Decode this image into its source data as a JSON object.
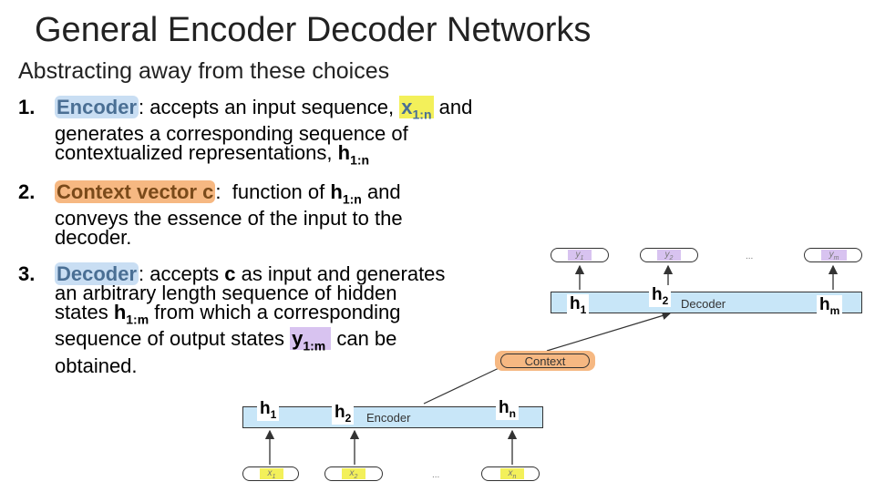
{
  "title": "General Encoder Decoder Networks",
  "subtitle": "Abstracting away from these choices",
  "items": [
    {
      "num": "1.",
      "keyword": "Encoder",
      "colon": ":",
      "l1a": " accepts an input sequence, ",
      "l1x": "x",
      "l1xsub": "1:n",
      "l1b": " and",
      "l2": "generates a corresponding sequence of",
      "l3a": "contextualized representations, ",
      "l3h": "h",
      "l3hsub": "1:n"
    },
    {
      "num": "2.",
      "keyword": "Context vector c",
      "colon": ":",
      "l1a": "  function of ",
      "l1h": "h",
      "l1hsub": "1:n",
      "l1b": " and",
      "l2": "conveys the essence of the input to the",
      "l3": "decoder."
    },
    {
      "num": "3.",
      "keyword": "Decoder",
      "colon": ":",
      "l1a": " accepts ",
      "l1c": "c",
      "l1b": " as input and generates",
      "l2": "an arbitrary length sequence of hidden",
      "l3a": "states ",
      "l3h": "h",
      "l3hsub": "1:m",
      "l3b": " from which a corresponding",
      "l4a": "sequence of output states ",
      "l4y": "y",
      "l4ysub": "1:m",
      "l4b": " can be",
      "l5": "obtained."
    }
  ],
  "diagram": {
    "encoder_label": "Encoder",
    "decoder_label": "Decoder",
    "context_label": "Context",
    "enc_h": [
      {
        "h": "h",
        "s": "1"
      },
      {
        "h": "h",
        "s": "2"
      },
      {
        "h": "h",
        "s": "n"
      }
    ],
    "dec_h": [
      {
        "h": "h",
        "s": "1"
      },
      {
        "h": "h",
        "s": "2"
      },
      {
        "h": "h",
        "s": "m"
      }
    ],
    "inputs": [
      {
        "v": "x",
        "s": "1"
      },
      {
        "v": "x",
        "s": "2"
      },
      {
        "v": "x",
        "s": "n"
      }
    ],
    "outputs": [
      {
        "v": "y",
        "s": "1"
      },
      {
        "v": "y",
        "s": "2"
      },
      {
        "v": "y",
        "s": "m"
      }
    ],
    "ellipsis": "..."
  }
}
